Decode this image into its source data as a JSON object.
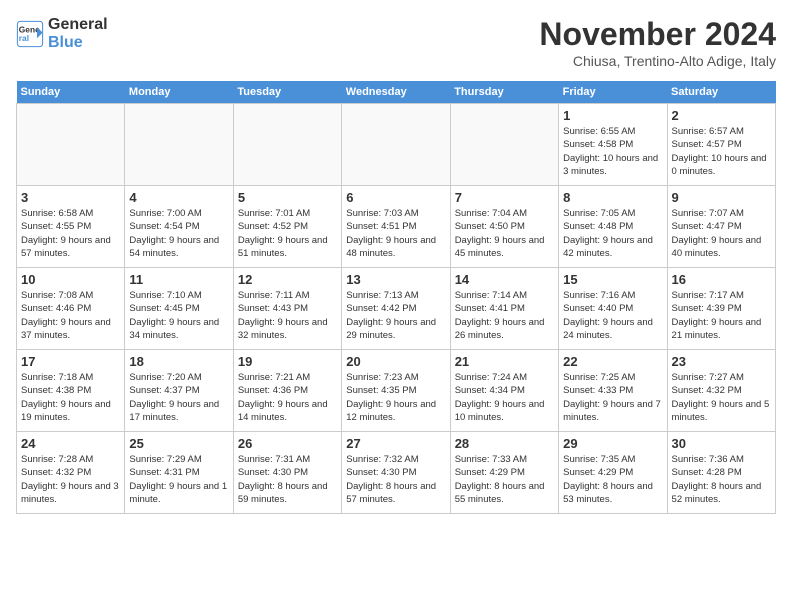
{
  "header": {
    "logo_line1": "General",
    "logo_line2": "Blue",
    "month_year": "November 2024",
    "location": "Chiusa, Trentino-Alto Adige, Italy"
  },
  "days_of_week": [
    "Sunday",
    "Monday",
    "Tuesday",
    "Wednesday",
    "Thursday",
    "Friday",
    "Saturday"
  ],
  "weeks": [
    [
      {
        "day": "",
        "sunrise": "",
        "sunset": "",
        "daylight": ""
      },
      {
        "day": "",
        "sunrise": "",
        "sunset": "",
        "daylight": ""
      },
      {
        "day": "",
        "sunrise": "",
        "sunset": "",
        "daylight": ""
      },
      {
        "day": "",
        "sunrise": "",
        "sunset": "",
        "daylight": ""
      },
      {
        "day": "",
        "sunrise": "",
        "sunset": "",
        "daylight": ""
      },
      {
        "day": "1",
        "sunrise": "Sunrise: 6:55 AM",
        "sunset": "Sunset: 4:58 PM",
        "daylight": "Daylight: 10 hours and 3 minutes."
      },
      {
        "day": "2",
        "sunrise": "Sunrise: 6:57 AM",
        "sunset": "Sunset: 4:57 PM",
        "daylight": "Daylight: 10 hours and 0 minutes."
      }
    ],
    [
      {
        "day": "3",
        "sunrise": "Sunrise: 6:58 AM",
        "sunset": "Sunset: 4:55 PM",
        "daylight": "Daylight: 9 hours and 57 minutes."
      },
      {
        "day": "4",
        "sunrise": "Sunrise: 7:00 AM",
        "sunset": "Sunset: 4:54 PM",
        "daylight": "Daylight: 9 hours and 54 minutes."
      },
      {
        "day": "5",
        "sunrise": "Sunrise: 7:01 AM",
        "sunset": "Sunset: 4:52 PM",
        "daylight": "Daylight: 9 hours and 51 minutes."
      },
      {
        "day": "6",
        "sunrise": "Sunrise: 7:03 AM",
        "sunset": "Sunset: 4:51 PM",
        "daylight": "Daylight: 9 hours and 48 minutes."
      },
      {
        "day": "7",
        "sunrise": "Sunrise: 7:04 AM",
        "sunset": "Sunset: 4:50 PM",
        "daylight": "Daylight: 9 hours and 45 minutes."
      },
      {
        "day": "8",
        "sunrise": "Sunrise: 7:05 AM",
        "sunset": "Sunset: 4:48 PM",
        "daylight": "Daylight: 9 hours and 42 minutes."
      },
      {
        "day": "9",
        "sunrise": "Sunrise: 7:07 AM",
        "sunset": "Sunset: 4:47 PM",
        "daylight": "Daylight: 9 hours and 40 minutes."
      }
    ],
    [
      {
        "day": "10",
        "sunrise": "Sunrise: 7:08 AM",
        "sunset": "Sunset: 4:46 PM",
        "daylight": "Daylight: 9 hours and 37 minutes."
      },
      {
        "day": "11",
        "sunrise": "Sunrise: 7:10 AM",
        "sunset": "Sunset: 4:45 PM",
        "daylight": "Daylight: 9 hours and 34 minutes."
      },
      {
        "day": "12",
        "sunrise": "Sunrise: 7:11 AM",
        "sunset": "Sunset: 4:43 PM",
        "daylight": "Daylight: 9 hours and 32 minutes."
      },
      {
        "day": "13",
        "sunrise": "Sunrise: 7:13 AM",
        "sunset": "Sunset: 4:42 PM",
        "daylight": "Daylight: 9 hours and 29 minutes."
      },
      {
        "day": "14",
        "sunrise": "Sunrise: 7:14 AM",
        "sunset": "Sunset: 4:41 PM",
        "daylight": "Daylight: 9 hours and 26 minutes."
      },
      {
        "day": "15",
        "sunrise": "Sunrise: 7:16 AM",
        "sunset": "Sunset: 4:40 PM",
        "daylight": "Daylight: 9 hours and 24 minutes."
      },
      {
        "day": "16",
        "sunrise": "Sunrise: 7:17 AM",
        "sunset": "Sunset: 4:39 PM",
        "daylight": "Daylight: 9 hours and 21 minutes."
      }
    ],
    [
      {
        "day": "17",
        "sunrise": "Sunrise: 7:18 AM",
        "sunset": "Sunset: 4:38 PM",
        "daylight": "Daylight: 9 hours and 19 minutes."
      },
      {
        "day": "18",
        "sunrise": "Sunrise: 7:20 AM",
        "sunset": "Sunset: 4:37 PM",
        "daylight": "Daylight: 9 hours and 17 minutes."
      },
      {
        "day": "19",
        "sunrise": "Sunrise: 7:21 AM",
        "sunset": "Sunset: 4:36 PM",
        "daylight": "Daylight: 9 hours and 14 minutes."
      },
      {
        "day": "20",
        "sunrise": "Sunrise: 7:23 AM",
        "sunset": "Sunset: 4:35 PM",
        "daylight": "Daylight: 9 hours and 12 minutes."
      },
      {
        "day": "21",
        "sunrise": "Sunrise: 7:24 AM",
        "sunset": "Sunset: 4:34 PM",
        "daylight": "Daylight: 9 hours and 10 minutes."
      },
      {
        "day": "22",
        "sunrise": "Sunrise: 7:25 AM",
        "sunset": "Sunset: 4:33 PM",
        "daylight": "Daylight: 9 hours and 7 minutes."
      },
      {
        "day": "23",
        "sunrise": "Sunrise: 7:27 AM",
        "sunset": "Sunset: 4:32 PM",
        "daylight": "Daylight: 9 hours and 5 minutes."
      }
    ],
    [
      {
        "day": "24",
        "sunrise": "Sunrise: 7:28 AM",
        "sunset": "Sunset: 4:32 PM",
        "daylight": "Daylight: 9 hours and 3 minutes."
      },
      {
        "day": "25",
        "sunrise": "Sunrise: 7:29 AM",
        "sunset": "Sunset: 4:31 PM",
        "daylight": "Daylight: 9 hours and 1 minute."
      },
      {
        "day": "26",
        "sunrise": "Sunrise: 7:31 AM",
        "sunset": "Sunset: 4:30 PM",
        "daylight": "Daylight: 8 hours and 59 minutes."
      },
      {
        "day": "27",
        "sunrise": "Sunrise: 7:32 AM",
        "sunset": "Sunset: 4:30 PM",
        "daylight": "Daylight: 8 hours and 57 minutes."
      },
      {
        "day": "28",
        "sunrise": "Sunrise: 7:33 AM",
        "sunset": "Sunset: 4:29 PM",
        "daylight": "Daylight: 8 hours and 55 minutes."
      },
      {
        "day": "29",
        "sunrise": "Sunrise: 7:35 AM",
        "sunset": "Sunset: 4:29 PM",
        "daylight": "Daylight: 8 hours and 53 minutes."
      },
      {
        "day": "30",
        "sunrise": "Sunrise: 7:36 AM",
        "sunset": "Sunset: 4:28 PM",
        "daylight": "Daylight: 8 hours and 52 minutes."
      }
    ]
  ]
}
